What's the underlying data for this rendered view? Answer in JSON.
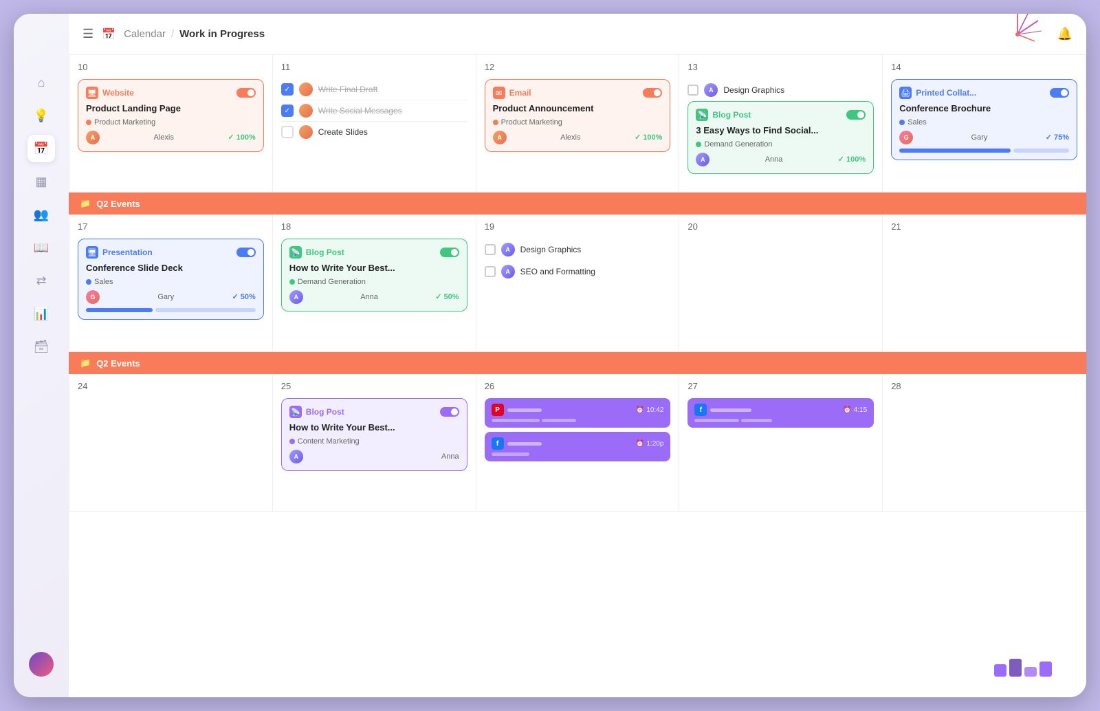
{
  "app": {
    "title": "Calendar",
    "breadcrumb_sep": "/",
    "breadcrumb_current": "Work in Progress"
  },
  "sidebar": {
    "icons": [
      "menu",
      "home",
      "lightbulb",
      "calendar",
      "table",
      "users",
      "book",
      "shuffle",
      "bar-chart",
      "archive"
    ]
  },
  "header": {
    "bell_label": "🔔"
  },
  "calendar": {
    "week1": {
      "days": [
        {
          "num": "10",
          "has_card": true
        },
        {
          "num": "11",
          "has_checklist": true
        },
        {
          "num": "12",
          "has_card": true
        },
        {
          "num": "13",
          "has_tasks": true
        },
        {
          "num": "14",
          "has_card": true
        }
      ]
    },
    "q2_banner": "Q2 Events",
    "cards": {
      "website": {
        "type": "Website",
        "title": "Product Landing Page",
        "tag": "Product Marketing",
        "assignee": "Alexis",
        "percent": "100%"
      },
      "email": {
        "type": "Email",
        "title": "Product Announcement",
        "tag": "Product Marketing",
        "assignee": "Alexis",
        "percent": "100%"
      },
      "blog_post_13": {
        "type": "Blog Post",
        "title": "3 Easy Ways to Find Social...",
        "tag": "Demand Generation",
        "assignee": "Anna",
        "percent": "100%"
      },
      "printed": {
        "type": "Printed Collat...",
        "title": "Conference Brochure",
        "tag": "Sales",
        "assignee": "Gary",
        "percent": "75%"
      },
      "presentation": {
        "type": "Presentation",
        "title": "Conference Slide Deck",
        "tag": "Sales",
        "assignee": "Gary",
        "percent": "50%"
      },
      "blog_post_18": {
        "type": "Blog Post",
        "title": "How to Write Your Best...",
        "tag": "Demand Generation",
        "assignee": "Anna",
        "percent": "50%"
      },
      "blog_post_25": {
        "type": "Blog Post",
        "title": "How to Write Your Best...",
        "tag": "Content Marketing",
        "assignee": "Anna",
        "percent": ""
      }
    },
    "checklist_11": [
      {
        "done": true,
        "text": "Write Final Draft"
      },
      {
        "done": true,
        "text": "Write Social Messages"
      },
      {
        "done": false,
        "text": "Create Slides"
      }
    ],
    "tasks_13": [
      {
        "text": "Design Graphics"
      },
      {
        "text": ""
      }
    ],
    "tasks_19": [
      {
        "text": "Design Graphics"
      },
      {
        "text": "SEO and Formatting"
      }
    ],
    "social_26": [
      {
        "platform": "P",
        "time": "10:42",
        "platform_type": "pinterest"
      },
      {
        "platform": "f",
        "time": "1:20p",
        "platform_type": "facebook"
      }
    ],
    "social_27": [
      {
        "platform": "f",
        "time": "4:15",
        "platform_type": "facebook"
      }
    ]
  }
}
